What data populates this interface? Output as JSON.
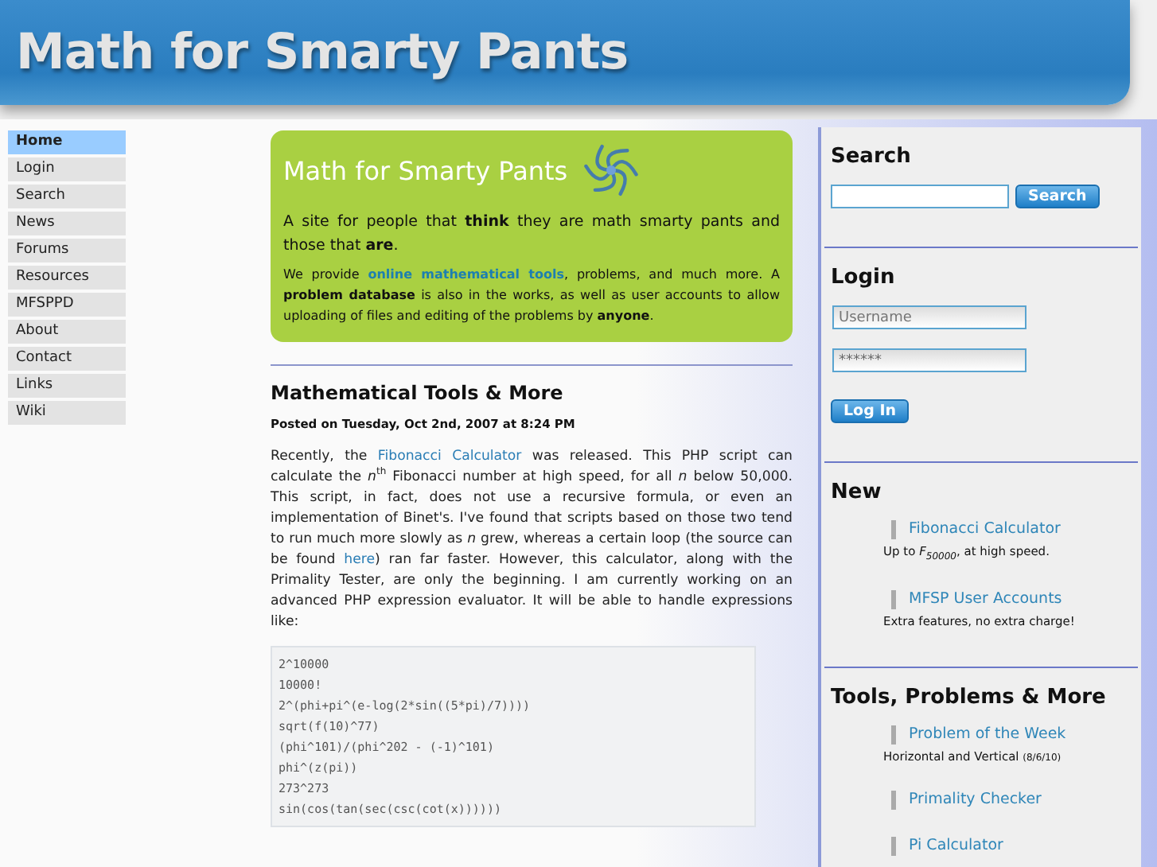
{
  "header": {
    "title": "Math for Smarty Pants"
  },
  "nav": [
    {
      "label": "Home",
      "selected": true
    },
    {
      "label": "Login",
      "selected": false
    },
    {
      "label": "Search",
      "selected": false
    },
    {
      "label": "News",
      "selected": false
    },
    {
      "label": "Forums",
      "selected": false
    },
    {
      "label": "Resources",
      "selected": false
    },
    {
      "label": "MFSPPD",
      "selected": false
    },
    {
      "label": "About",
      "selected": false
    },
    {
      "label": "Contact",
      "selected": false
    },
    {
      "label": "Links",
      "selected": false
    },
    {
      "label": "Wiki",
      "selected": false
    }
  ],
  "intro": {
    "title": "Math for Smarty Pants",
    "paragraphs": [
      [
        {
          "kind": "plain",
          "text": "A site for people that "
        },
        {
          "kind": "bold",
          "text": "think"
        },
        {
          "kind": "plain",
          "text": " they are math smarty pants and those that "
        },
        {
          "kind": "bold",
          "text": "are"
        },
        {
          "kind": "plain",
          "text": "."
        }
      ],
      [
        {
          "kind": "plain",
          "text": "We provide "
        },
        {
          "kind": "link",
          "text": "online mathematical tools"
        },
        {
          "kind": "plain",
          "text": ", problems, and much more. A "
        },
        {
          "kind": "bold",
          "text": "problem database"
        },
        {
          "kind": "plain",
          "text": " is also in the works, as well as user accounts to allow uploading of files and editing of the problems by "
        },
        {
          "kind": "bold",
          "text": "anyone"
        },
        {
          "kind": "plain",
          "text": "."
        }
      ]
    ]
  },
  "post": {
    "title": "Mathematical Tools & More",
    "meta": "Posted on Tuesday, Oct 2nd, 2007 at 8:24 PM",
    "paragraph": [
      {
        "kind": "plain",
        "text": "Recently,  the "
      },
      {
        "kind": "link",
        "text": "Fibonacci Calculator"
      },
      {
        "kind": "plain",
        "text": " was released. This PHP script can calculate the "
      },
      {
        "kind": "italic",
        "text": "n"
      },
      {
        "kind": "sup",
        "text": "th"
      },
      {
        "kind": "plain",
        "text": " Fibonacci number at high speed, for all "
      },
      {
        "kind": "italic",
        "text": "n"
      },
      {
        "kind": "plain",
        "text": " below 50,000. This script, in fact, does not use a recursive formula, or even an implementation of Binet's. I've found that scripts based on those two tend to run much more slowly as "
      },
      {
        "kind": "italic",
        "text": "n"
      },
      {
        "kind": "plain",
        "text": " grew, whereas a certain loop (the source can be found "
      },
      {
        "kind": "link",
        "text": "here"
      },
      {
        "kind": "plain",
        "text": ") ran far faster. However, this calculator, along with the Primality Tester, are only the beginning. I am currently working on an advanced PHP expression evaluator. It will be able to handle expressions like:"
      }
    ],
    "code_lines": [
      "2^10000",
      "10000!",
      "2^(phi+pi^(e-log(2*sin((5*pi)/7))))",
      "sqrt(f(10)^77)",
      "(phi^101)/(phi^202 - (-1)^101)",
      "phi^(z(pi))",
      "273^273",
      "sin(cos(tan(sec(csc(cot(x))))))"
    ]
  },
  "sidebar": {
    "search": {
      "heading": "Search",
      "button": "Search"
    },
    "login": {
      "heading": "Login",
      "username_placeholder": "Username",
      "password_value": "******",
      "button": "Log In"
    },
    "new": {
      "heading": "New",
      "items": [
        {
          "title": "Fibonacci Calculator",
          "description": [
            {
              "kind": "plain",
              "text": "Up to "
            },
            {
              "kind": "italic",
              "text": "F"
            },
            {
              "kind": "sub",
              "text": "50000"
            },
            {
              "kind": "plain",
              "text": ", at high speed."
            }
          ]
        },
        {
          "title": "MFSP User Accounts",
          "description": [
            {
              "kind": "plain",
              "text": "Extra features, no extra charge!"
            }
          ]
        }
      ]
    },
    "tools": {
      "heading": "Tools, Problems & More",
      "items": [
        {
          "title": "Problem of the Week",
          "description": [
            {
              "kind": "plain",
              "text": "Horizontal and Vertical "
            },
            {
              "kind": "small",
              "text": "(8/6/10)"
            }
          ]
        },
        {
          "title": "Primality Checker"
        },
        {
          "title": "Pi Calculator"
        }
      ]
    }
  }
}
